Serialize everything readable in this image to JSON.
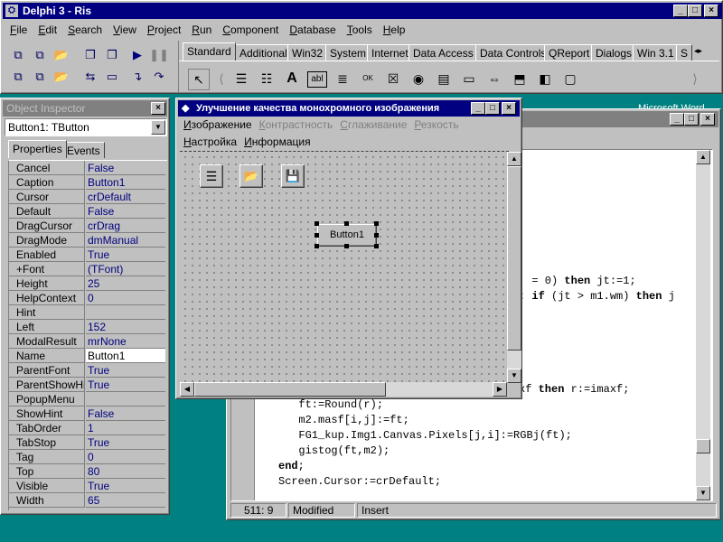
{
  "ide": {
    "title": "Delphi 3 - Ris",
    "menu": [
      "File",
      "Edit",
      "Search",
      "View",
      "Project",
      "Run",
      "Component",
      "Database",
      "Tools",
      "Help"
    ],
    "palette_tabs": [
      "Standard",
      "Additional",
      "Win32",
      "System",
      "Internet",
      "Data Access",
      "Data Controls",
      "QReport",
      "Dialogs",
      "Win 3.1",
      "S"
    ],
    "active_tab": "Standard"
  },
  "object_inspector": {
    "title": "Object Inspector",
    "selected": "Button1: TButton",
    "tabs": [
      "Properties",
      "Events"
    ],
    "properties": [
      {
        "name": "Cancel",
        "value": "False"
      },
      {
        "name": "Caption",
        "value": "Button1"
      },
      {
        "name": "Cursor",
        "value": "crDefault"
      },
      {
        "name": "Default",
        "value": "False"
      },
      {
        "name": "DragCursor",
        "value": "crDrag"
      },
      {
        "name": "DragMode",
        "value": "dmManual"
      },
      {
        "name": "Enabled",
        "value": "True"
      },
      {
        "name": "+Font",
        "value": "(TFont)"
      },
      {
        "name": "Height",
        "value": "25"
      },
      {
        "name": "HelpContext",
        "value": "0"
      },
      {
        "name": "Hint",
        "value": ""
      },
      {
        "name": "Left",
        "value": "152"
      },
      {
        "name": "ModalResult",
        "value": "mrNone"
      },
      {
        "name": "Name",
        "value": "Button1"
      },
      {
        "name": "ParentFont",
        "value": "True"
      },
      {
        "name": "ParentShowHint",
        "value": "True"
      },
      {
        "name": "PopupMenu",
        "value": ""
      },
      {
        "name": "ShowHint",
        "value": "False"
      },
      {
        "name": "TabOrder",
        "value": "1"
      },
      {
        "name": "TabStop",
        "value": "True"
      },
      {
        "name": "Tag",
        "value": "0"
      },
      {
        "name": "Top",
        "value": "80"
      },
      {
        "name": "Visible",
        "value": "True"
      },
      {
        "name": "Width",
        "value": "65"
      }
    ]
  },
  "form": {
    "title": "Улучшение качества монохромного изображения",
    "menu1": [
      "Изображение",
      "Контрастность",
      "Сглаживание",
      "Резкость"
    ],
    "menu2": [
      "Настройка",
      "Информация"
    ],
    "button_caption": "Button1"
  },
  "editor": {
    "background_label": "Microsoft Word",
    "lines": [
      {
        "pre": "  = 0) ",
        "kw": "then",
        "post": " jt:=1;"
      },
      {
        "pre": ": ",
        "kw": "if",
        "post": " (jt > m1.wm) ",
        "kw2": "then",
        "post2": " j"
      },
      {
        "pre": "xf ",
        "kw": "then",
        "post": " r:=imaxf;"
      },
      {
        "pre": "  ft:=Round(r);"
      },
      {
        "pre": "  m2.masf[i,j]:=ft;"
      },
      {
        "pre": "  FG1_kup.Img1.Canvas.Pixels[j,i]:=RGBj(ft);"
      },
      {
        "pre": "  gistog(ft,m2);"
      },
      {
        "pre": "",
        "kw": "end",
        "post": ";"
      },
      {
        "pre": "Screen.Cursor:=crDefault;"
      }
    ],
    "status": {
      "position": "511:  9",
      "modified": "Modified",
      "mode": "Insert"
    }
  },
  "colors": {
    "titlebar": "#000080",
    "teal": "#008080",
    "face": "#c0c0c0"
  }
}
